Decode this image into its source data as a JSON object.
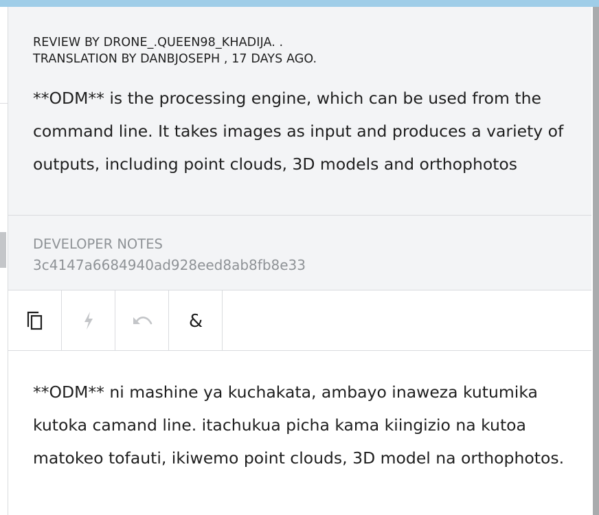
{
  "review": {
    "reviewer_line": "REVIEW BY DRONE_.QUEEN98_KHADIJA. .",
    "translator_line": "TRANSLATION BY DANBJOSEPH , 17 DAYS AGO."
  },
  "source_text": "**ODM** is the processing engine, which can be used from the command line. It takes images as input and produces a variety of outputs, including point clouds, 3D models and orthophotos",
  "developer_notes": {
    "label": "DEVELOPER NOTES",
    "value": "3c4147a6684940ad928eed8ab8fb8e33"
  },
  "toolbar": {
    "icons": [
      "copy-icon",
      "lightning-icon",
      "undo-icon",
      "ampersand-icon"
    ],
    "ampersand_glyph": "&"
  },
  "translation_text": "**ODM** ni mashine ya kuchakata, ambayo inaweza kutumika kutoka camand line. itachukua picha kama kiingizio na kutoa matokeo tofauti, ikiwemo point clouds, 3D model na orthophotos.",
  "colors": {
    "topbar": "#9fcde8",
    "panel_bg": "#f3f4f6",
    "muted_text": "#8e9296",
    "text": "#1e1e1e",
    "disabled_icon": "#c3c5c8"
  }
}
